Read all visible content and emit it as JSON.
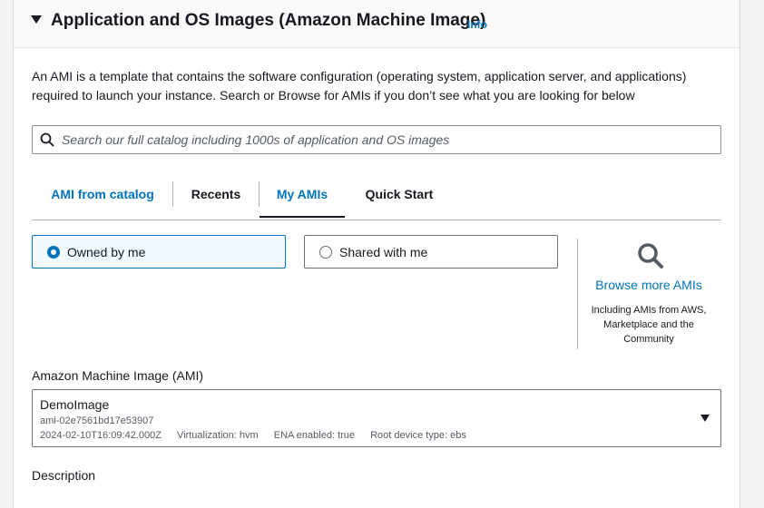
{
  "section": {
    "title": "Application and OS Images (Amazon Machine Image)",
    "info_label": "Info",
    "description": "An AMI is a template that contains the software configuration (operating system, application server, and applications) required to launch your instance. Search or Browse for AMIs if you don’t see what you are looking for below"
  },
  "search": {
    "placeholder": "Search our full catalog including 1000s of application and OS images",
    "value": ""
  },
  "tabs": [
    {
      "label": "AMI from catalog",
      "state": "link"
    },
    {
      "label": "Recents",
      "state": "default"
    },
    {
      "label": "My AMIs",
      "state": "active"
    },
    {
      "label": "Quick Start",
      "state": "default"
    }
  ],
  "ownership": {
    "options": [
      {
        "label": "Owned by me",
        "selected": true
      },
      {
        "label": "Shared with me",
        "selected": false
      }
    ]
  },
  "browse": {
    "link_label": "Browse more AMIs",
    "subtext": "Including AMIs from AWS, Marketplace and the Community"
  },
  "ami": {
    "field_label": "Amazon Machine Image (AMI)",
    "selected_name": "DemoImage",
    "selected_id": "ami-02e7561bd17e53907",
    "meta": {
      "timestamp": "2024-02-10T16:09:42.000Z",
      "virtualization": "Virtualization: hvm",
      "ena": "ENA enabled: true",
      "root_device": "Root device type: ebs"
    }
  },
  "description_field": {
    "label": "Description"
  },
  "colors": {
    "link_blue": "#0073bb",
    "text": "#16191f",
    "selected_bg": "#f1faff"
  }
}
